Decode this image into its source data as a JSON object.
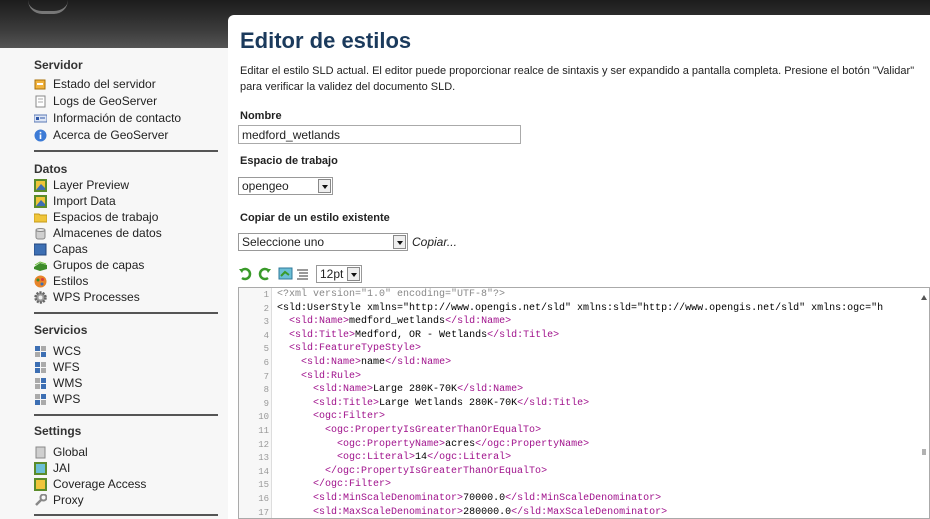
{
  "sidebar": {
    "sections": [
      {
        "title": "Servidor",
        "items": [
          {
            "label": "Estado del servidor",
            "icon": "server-status-icon"
          },
          {
            "label": "Logs de GeoServer",
            "icon": "document-icon"
          },
          {
            "label": "Información de contacto",
            "icon": "contact-card-icon"
          },
          {
            "label": "Acerca de GeoServer",
            "icon": "info-icon"
          }
        ]
      },
      {
        "title": "Datos",
        "items": [
          {
            "label": "Layer Preview",
            "icon": "layer-preview-icon"
          },
          {
            "label": "Import Data",
            "icon": "import-data-icon"
          },
          {
            "label": "Espacios de trabajo",
            "icon": "folder-icon"
          },
          {
            "label": "Almacenes de datos",
            "icon": "database-icon"
          },
          {
            "label": "Capas",
            "icon": "layer-icon"
          },
          {
            "label": "Grupos de capas",
            "icon": "layer-group-icon"
          },
          {
            "label": "Estilos",
            "icon": "style-palette-icon"
          },
          {
            "label": "WPS Processes",
            "icon": "gear-icon"
          }
        ]
      },
      {
        "title": "Servicios",
        "items": [
          {
            "label": "WCS",
            "icon": "wcs-service-icon"
          },
          {
            "label": "WFS",
            "icon": "wfs-service-icon"
          },
          {
            "label": "WMS",
            "icon": "wms-service-icon"
          },
          {
            "label": "WPS",
            "icon": "wps-service-icon"
          }
        ]
      },
      {
        "title": "Settings",
        "items": [
          {
            "label": "Global",
            "icon": "global-settings-icon"
          },
          {
            "label": "JAI",
            "icon": "jai-icon"
          },
          {
            "label": "Coverage Access",
            "icon": "coverage-access-icon"
          },
          {
            "label": "Proxy",
            "icon": "proxy-icon"
          }
        ]
      }
    ]
  },
  "main": {
    "title": "Editor de estilos",
    "description": "Editar el estilo SLD actual. El editor puede proporcionar realce de sintaxis y ser expandido a pantalla completa. Presione el botón \"Validar\" para verificar la validez del documento SLD.",
    "name_label": "Nombre",
    "name_value": "medford_wetlands",
    "workspace_label": "Espacio de trabajo",
    "workspace_value": "opengeo",
    "copy_label": "Copiar de un estilo existente",
    "copy_select_value": "Seleccione uno",
    "copy_link": "Copiar...",
    "font_size_value": "12pt"
  },
  "editor": {
    "lines": [
      "<?xml version=\"1.0\" encoding=\"UTF-8\"?>",
      "<sld:UserStyle xmlns=\"http://www.opengis.net/sld\" xmlns:sld=\"http://www.opengis.net/sld\" xmlns:ogc=\"h",
      "  <sld:Name>medford_wetlands</sld:Name>",
      "  <sld:Title>Medford, OR - Wetlands</sld:Title>",
      "  <sld:FeatureTypeStyle>",
      "    <sld:Name>name</sld:Name>",
      "    <sld:Rule>",
      "      <sld:Name>Large 280K-70K</sld:Name>",
      "      <sld:Title>Large Wetlands 280K-70K</sld:Title>",
      "      <ogc:Filter>",
      "        <ogc:PropertyIsGreaterThanOrEqualTo>",
      "          <ogc:PropertyName>acres</ogc:PropertyName>",
      "          <ogc:Literal>14</ogc:Literal>",
      "        </ogc:PropertyIsGreaterThanOrEqualTo>",
      "      </ogc:Filter>",
      "      <sld:MinScaleDenominator>70000.0</sld:MinScaleDenominator>",
      "      <sld:MaxScaleDenominator>280000.0</sld:MaxScaleDenominator>"
    ]
  }
}
